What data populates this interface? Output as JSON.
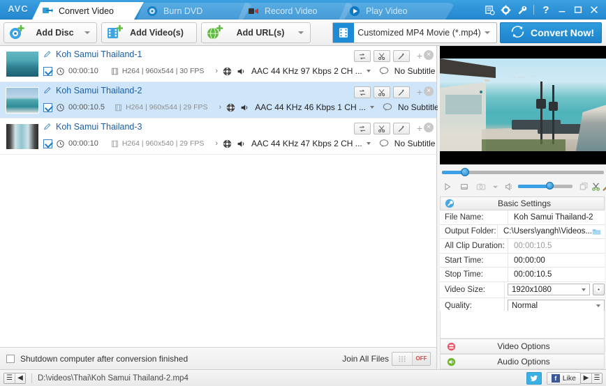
{
  "app": {
    "logo": "AVC",
    "tabs": [
      {
        "label": "Convert Video",
        "icon": "convert-video-icon",
        "active": true
      },
      {
        "label": "Burn DVD",
        "icon": "burn-dvd-icon",
        "active": false
      },
      {
        "label": "Record Video",
        "icon": "record-video-icon",
        "active": false
      },
      {
        "label": "Play Video",
        "icon": "play-video-icon",
        "active": false
      }
    ],
    "window_buttons": [
      {
        "name": "list-settings-icon",
        "label": ""
      },
      {
        "name": "gear-icon",
        "label": ""
      },
      {
        "name": "wrench-icon",
        "label": ""
      },
      {
        "name": "help-icon",
        "label": "?"
      },
      {
        "name": "minimize-icon",
        "label": ""
      },
      {
        "name": "maximize-icon",
        "label": ""
      },
      {
        "name": "close-icon",
        "label": ""
      }
    ]
  },
  "toolbar": {
    "add_disc": "Add Disc",
    "add_videos": "Add Video(s)",
    "add_urls": "Add URL(s)",
    "format": "Customized MP4 Movie (*.mp4)",
    "convert": "Convert Now!"
  },
  "files": [
    {
      "title": "Koh Samui Thailand-1",
      "checked": true,
      "duration": "00:00:10",
      "video_info": "H264 | 960x544 | 30 FPS",
      "audio": "AAC 44 KHz 97 Kbps 2 CH ...",
      "subtitle": "No Subtitle",
      "selected": false,
      "thumb_style": "beach-aerial"
    },
    {
      "title": "Koh Samui Thailand-2",
      "checked": true,
      "duration": "00:00:10.5",
      "video_info": "H264 | 960x544 | 29 FPS",
      "audio": "AAC 44 KHz 46 Kbps 1 CH ...",
      "subtitle": "No Subtitle",
      "selected": true,
      "thumb_style": "sea-horizon"
    },
    {
      "title": "Koh Samui Thailand-3",
      "checked": true,
      "duration": "00:00:10",
      "video_info": "H264 | 960x540 | 29 FPS",
      "audio": "AAC 44 KHz 47 Kbps 2 CH ...",
      "subtitle": "No Subtitle",
      "selected": false,
      "thumb_style": "window-view"
    }
  ],
  "row_buttons": {
    "rotate": "rotate-icon",
    "trim": "scissors-icon",
    "effect": "magic-wand-icon",
    "add": "+",
    "remove": "×"
  },
  "options_bar": {
    "shutdown_label": "Shutdown computer after conversion finished",
    "shutdown_checked": false,
    "join_label": "Join All Files",
    "join_state": "OFF"
  },
  "right_panel": {
    "basic_settings_title": "Basic Settings",
    "basic_settings_icon": "wrench-icon",
    "properties": [
      {
        "key": "File Name:",
        "value": "Koh Samui Thailand-2",
        "type": "text",
        "dim": false
      },
      {
        "key": "Output Folder:",
        "value": "C:\\Users\\yangh\\Videos...",
        "type": "folder",
        "dim": false
      },
      {
        "key": "All Clip Duration:",
        "value": "00:00:10.5",
        "type": "text",
        "dim": true
      },
      {
        "key": "Start Time:",
        "value": "00:00:00",
        "type": "text",
        "dim": false
      },
      {
        "key": "Stop Time:",
        "value": "00:00:10.5",
        "type": "text",
        "dim": false
      },
      {
        "key": "Video Size:",
        "value": "1920x1080",
        "type": "select-gear",
        "dim": false
      },
      {
        "key": "Quality:",
        "value": "Normal",
        "type": "select",
        "dim": false
      }
    ],
    "video_options": "Video Options",
    "audio_options": "Audio Options",
    "player": {
      "seek_percent": 14,
      "volume_percent": 58,
      "buttons": [
        "play-icon",
        "stop-icon",
        "snapshot-icon",
        "volume-icon",
        "fullscreen-icon",
        "cut-icon",
        "effect-icon"
      ]
    }
  },
  "status_bar": {
    "path": "D:\\videos\\Thai\\Koh Samui Thailand-2.mp4",
    "twitter": "twitter-icon",
    "like_label": "Like"
  },
  "colors": {
    "accent": "#2489d0",
    "convert_button": "#1d82c9",
    "selection": "#cfe6fa",
    "link": "#1a5fa8"
  }
}
